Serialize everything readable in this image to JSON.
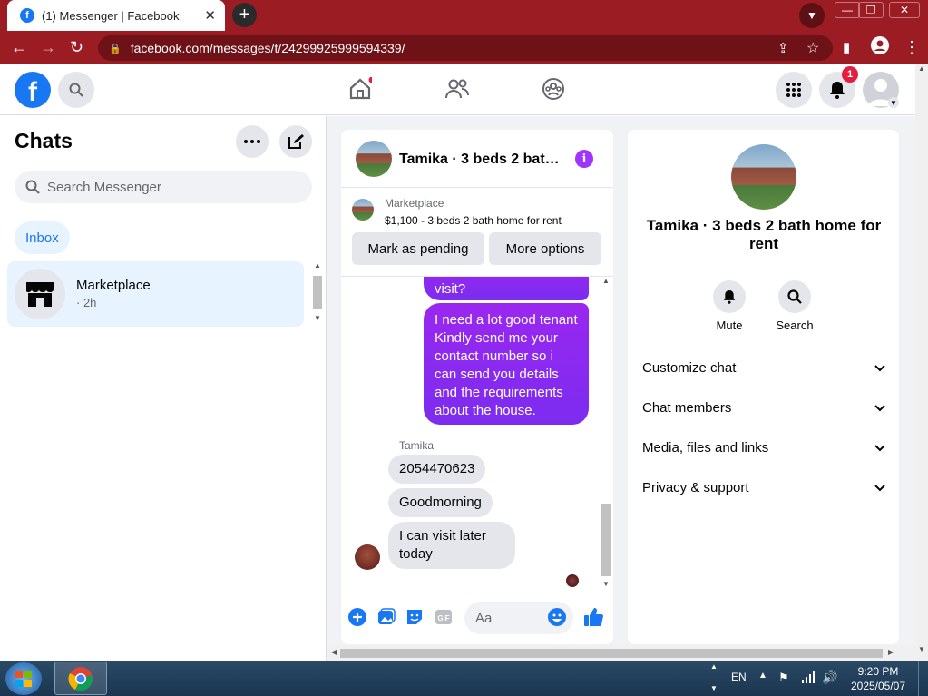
{
  "browser": {
    "tab_title": "(1) Messenger | Facebook",
    "url": "facebook.com/messages/t/24299925999594339/"
  },
  "fb": {
    "notification_count": "1"
  },
  "chats": {
    "title": "Chats",
    "search_placeholder": "Search Messenger",
    "inbox_label": "Inbox",
    "items": [
      {
        "name": "Marketplace",
        "time": "· 2h"
      }
    ]
  },
  "conversation": {
    "title": "Tamika · 3 beds 2 bat…",
    "marketplace_label": "Marketplace",
    "listing": "$1,100 - 3 beds 2 bath home for rent",
    "mark_pending": "Mark as pending",
    "more_options": "More options",
    "messages_out": [
      {
        "text": "visit?"
      },
      {
        "text": "I need a lot good tenant Kindly send me your contact number so i can send you details and the requirements about the house."
      }
    ],
    "sender_name": "Tamika",
    "messages_in": [
      {
        "text": "2054470623"
      },
      {
        "text": "Goodmorning"
      },
      {
        "text": "I can visit later today"
      }
    ],
    "composer_placeholder": "Aa"
  },
  "details": {
    "title": "Tamika · 3 beds 2 bath home for rent",
    "actions": [
      {
        "label": "Mute"
      },
      {
        "label": "Search"
      }
    ],
    "sections": [
      {
        "label": "Customize chat"
      },
      {
        "label": "Chat members"
      },
      {
        "label": "Media, files and links"
      },
      {
        "label": "Privacy & support"
      }
    ]
  },
  "taskbar": {
    "language": "EN",
    "time": "9:20 PM",
    "date": "2025/05/07"
  },
  "colors": {
    "browser_frame": "#9c1c24",
    "fb_blue": "#1877f2",
    "messenger_purple": "#a033ff"
  }
}
